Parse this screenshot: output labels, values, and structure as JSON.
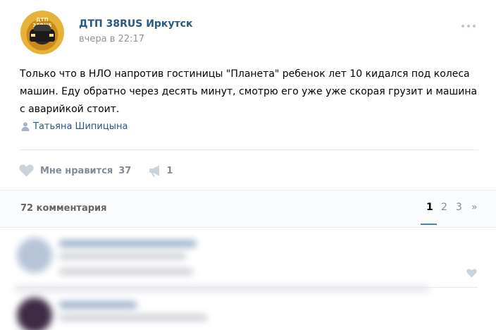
{
  "post": {
    "group_name": "ДТП 38RUS Иркутск",
    "date": "вчера в 22:17",
    "avatar_text": "ДТП 38RUS",
    "text": "Только что в НЛО напротив гостиницы \"Планета\" ребенок лет 10 кидался под колеса машин. Еду обратно через десять минут, смотрю его уже уже скорая грузит и машина с аварийкой стоит.",
    "author": "Татьяна Шипицына",
    "author_icon": "person-icon",
    "more_icon": "more-dots-icon"
  },
  "actions": {
    "like_icon": "heart-icon",
    "like_label": "Мне нравится",
    "like_count": "37",
    "share_icon": "megaphone-icon",
    "share_count": "1"
  },
  "comments": {
    "count_label": "72 комментария",
    "pages": [
      "1",
      "2",
      "3"
    ],
    "current_page": "1",
    "next_label": "»"
  },
  "colors": {
    "link": "#2a5885",
    "muted": "#828a99",
    "accent": "#5181b8",
    "divider": "#e7e8ec"
  }
}
